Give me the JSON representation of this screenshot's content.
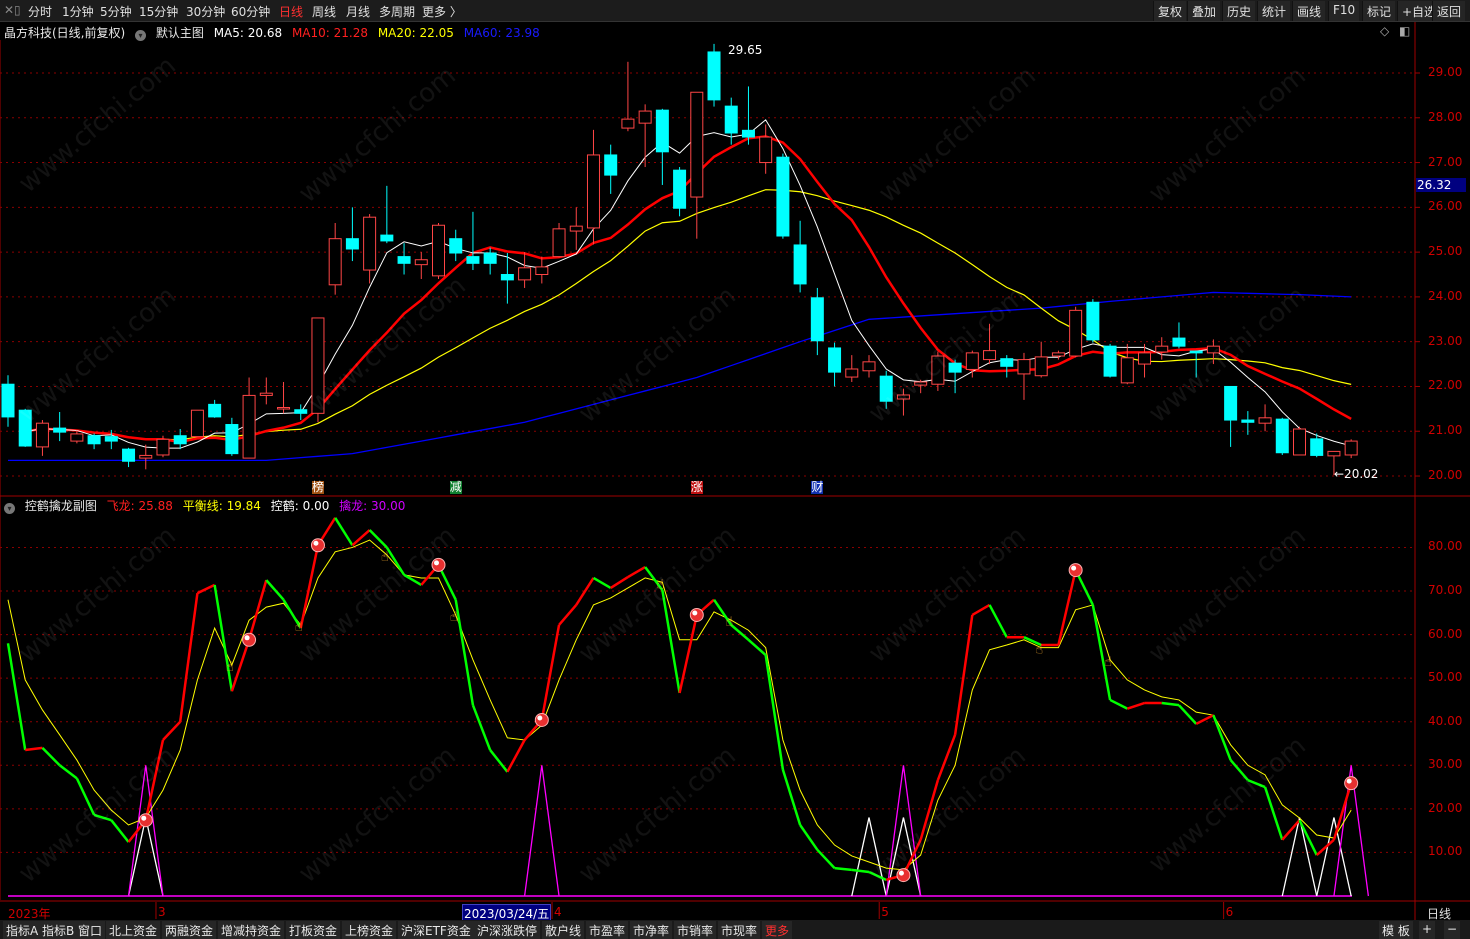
{
  "toolbar": {
    "periods": [
      "分时",
      "1分钟",
      "5分钟",
      "15分钟",
      "30分钟",
      "60分钟",
      "日线",
      "周线",
      "月线",
      "多周期",
      "更多 〉"
    ],
    "active_period": "日线",
    "right_buttons": [
      "复权",
      "叠加",
      "历史",
      "统计",
      "画线",
      "F10",
      "标记",
      "+自选",
      "返回"
    ]
  },
  "main": {
    "stock": "晶方科技(日线,前复权)",
    "template": "默认主图",
    "ma5": "MA5: 20.68",
    "ma10": "MA10: 21.28",
    "ma20": "MA20: 22.05",
    "ma60": "MA60: 23.98",
    "high_label": "29.65",
    "low_label": "←20.02",
    "cursor_price": "26.32",
    "price_ticks": [
      "29.00",
      "28.00",
      "27.00",
      "26.00",
      "25.00",
      "24.00",
      "23.00",
      "22.00",
      "21.00",
      "20.00"
    ],
    "markers": [
      {
        "text": "榜",
        "index": 18,
        "color": "#a05010"
      },
      {
        "text": "减",
        "index": 26,
        "color": "#108030"
      },
      {
        "text": "涨",
        "index": 40,
        "color": "#c01010"
      },
      {
        "text": "财",
        "index": 47,
        "color": "#1030b0"
      }
    ]
  },
  "sub": {
    "title": "控鹤擒龙副图",
    "feilong": "飞龙: 25.88",
    "pingheng": "平衡线: 19.84",
    "konghe": "控鹤: 0.00",
    "qinlong": "擒龙: 30.00",
    "ticks": [
      "80.00",
      "70.00",
      "60.00",
      "50.00",
      "40.00",
      "30.00",
      "20.00",
      "10.00"
    ]
  },
  "xaxis": {
    "year": "2023年",
    "months": [
      {
        "text": "3",
        "index": 9
      },
      {
        "text": "4",
        "index": 32
      },
      {
        "text": "5",
        "index": 51
      },
      {
        "text": "6",
        "index": 71
      }
    ],
    "cursor_date": "2023/03/24/五",
    "period": "日线"
  },
  "bottom": {
    "tabs": [
      "指标A",
      "指标B",
      "窗口",
      "北上资金",
      "两融资金",
      "增减持资金",
      "打板资金",
      "上榜资金",
      "沪深ETF资金",
      "沪深涨跌停",
      "散户线",
      "市盈率",
      "市净率",
      "市销率",
      "市现率",
      "更多"
    ],
    "right": [
      "模 板",
      "+",
      "−"
    ]
  },
  "watermark": "www.cfchi.com",
  "colors": {
    "up": "#ff4646",
    "down": "#00ffff",
    "ma5": "#ffffff",
    "ma10": "#ff0000",
    "ma20": "#ffff00",
    "ma60": "#0000ff",
    "grid": "#8b0000",
    "qinlong": "#ff00ff"
  },
  "chart_data": {
    "type": "candlestick",
    "ohlc": [
      [
        22.05,
        21.32,
        22.25,
        21.1
      ],
      [
        21.47,
        20.67,
        21.5,
        20.65
      ],
      [
        20.65,
        21.18,
        21.25,
        20.45
      ],
      [
        21.07,
        20.98,
        21.43,
        20.78
      ],
      [
        20.78,
        20.94,
        21.02,
        20.73
      ],
      [
        20.9,
        20.72,
        20.95,
        20.6
      ],
      [
        20.88,
        20.78,
        21.03,
        20.6
      ],
      [
        20.6,
        20.33,
        20.63,
        20.2
      ],
      [
        20.4,
        20.46,
        20.7,
        20.15
      ],
      [
        20.47,
        20.82,
        20.9,
        20.42
      ],
      [
        20.9,
        20.72,
        21.05,
        20.6
      ],
      [
        20.88,
        21.47,
        21.47,
        20.88
      ],
      [
        21.6,
        21.32,
        21.7,
        21.3
      ],
      [
        21.15,
        20.5,
        21.3,
        20.45
      ],
      [
        20.4,
        21.8,
        22.2,
        20.4
      ],
      [
        21.8,
        21.85,
        22.2,
        21.6
      ],
      [
        21.5,
        21.53,
        22.1,
        21.4
      ],
      [
        21.48,
        21.4,
        21.6,
        21.25
      ],
      [
        21.4,
        23.53,
        23.53,
        21.2
      ],
      [
        24.27,
        25.3,
        25.65,
        24.05
      ],
      [
        25.3,
        25.07,
        26.0,
        24.8
      ],
      [
        24.6,
        25.78,
        25.85,
        24.3
      ],
      [
        25.38,
        25.25,
        26.48,
        25.2
      ],
      [
        24.9,
        24.75,
        25.2,
        24.5
      ],
      [
        24.72,
        24.83,
        25.0,
        24.4
      ],
      [
        24.47,
        25.6,
        25.65,
        24.4
      ],
      [
        25.3,
        24.98,
        25.5,
        24.8
      ],
      [
        24.9,
        24.75,
        25.9,
        24.6
      ],
      [
        24.98,
        24.75,
        25.1,
        24.5
      ],
      [
        24.5,
        24.38,
        24.98,
        23.85
      ],
      [
        24.38,
        24.65,
        25.0,
        24.2
      ],
      [
        24.5,
        24.67,
        24.9,
        24.3
      ],
      [
        24.9,
        25.52,
        25.65,
        24.88
      ],
      [
        25.47,
        25.58,
        26.0,
        25.05
      ],
      [
        25.54,
        27.17,
        27.73,
        25.17
      ],
      [
        27.17,
        26.72,
        27.4,
        26.3
      ],
      [
        27.77,
        27.97,
        29.25,
        27.7
      ],
      [
        27.88,
        28.15,
        28.3,
        26.9
      ],
      [
        28.17,
        27.24,
        28.2,
        26.5
      ],
      [
        26.83,
        25.98,
        26.9,
        25.8
      ],
      [
        26.23,
        28.57,
        28.57,
        25.3
      ],
      [
        29.47,
        28.4,
        29.65,
        28.25
      ],
      [
        28.26,
        27.66,
        28.45,
        27.4
      ],
      [
        27.72,
        27.57,
        28.7,
        27.4
      ],
      [
        27.0,
        27.57,
        27.85,
        26.75
      ],
      [
        27.12,
        25.36,
        27.2,
        25.3
      ],
      [
        25.16,
        24.29,
        25.7,
        24.1
      ],
      [
        23.98,
        23.02,
        24.2,
        22.7
      ],
      [
        22.86,
        22.32,
        22.98,
        22.0
      ],
      [
        22.21,
        22.39,
        22.7,
        22.1
      ],
      [
        22.35,
        22.55,
        22.7,
        22.2
      ],
      [
        22.23,
        21.67,
        22.35,
        21.5
      ],
      [
        21.72,
        21.81,
        21.95,
        21.35
      ],
      [
        22.03,
        22.1,
        22.15,
        21.85
      ],
      [
        22.05,
        22.68,
        22.78,
        21.9
      ],
      [
        22.52,
        22.32,
        22.6,
        21.85
      ],
      [
        22.38,
        22.75,
        22.8,
        22.2
      ],
      [
        22.6,
        22.8,
        23.4,
        22.5
      ],
      [
        22.62,
        22.45,
        22.7,
        22.2
      ],
      [
        22.28,
        22.6,
        22.75,
        21.7
      ],
      [
        22.24,
        22.66,
        23.0,
        22.2
      ],
      [
        22.68,
        22.75,
        22.8,
        22.6
      ],
      [
        22.68,
        23.7,
        23.78,
        22.65
      ],
      [
        23.88,
        23.04,
        23.95,
        22.98
      ],
      [
        22.9,
        22.23,
        22.95,
        22.2
      ],
      [
        22.08,
        22.64,
        22.95,
        22.05
      ],
      [
        22.5,
        22.75,
        22.95,
        22.2
      ],
      [
        22.77,
        22.9,
        23.1,
        22.6
      ],
      [
        23.08,
        22.9,
        23.43,
        22.85
      ],
      [
        22.79,
        22.75,
        22.8,
        22.2
      ],
      [
        22.75,
        22.9,
        23.05,
        22.5
      ],
      [
        22.0,
        21.25,
        22.0,
        20.65
      ],
      [
        21.25,
        21.2,
        21.45,
        20.92
      ],
      [
        21.18,
        21.3,
        21.6,
        21.0
      ],
      [
        21.27,
        20.52,
        21.3,
        20.47
      ],
      [
        20.47,
        21.05,
        21.1,
        20.47
      ],
      [
        20.83,
        20.46,
        20.95,
        20.42
      ],
      [
        20.45,
        20.55,
        20.55,
        20.02
      ],
      [
        20.47,
        20.78,
        20.82,
        20.4
      ]
    ],
    "ma60_keypoints": [
      [
        0,
        20.35
      ],
      [
        15,
        20.35
      ],
      [
        20,
        20.5
      ],
      [
        30,
        21.2
      ],
      [
        40,
        22.2
      ],
      [
        46,
        23.0
      ],
      [
        50,
        23.5
      ],
      [
        60,
        23.75
      ],
      [
        64,
        23.9
      ],
      [
        70,
        24.1
      ],
      [
        75,
        24.05
      ],
      [
        78,
        24.0
      ]
    ],
    "price_range": [
      19.5,
      29.9
    ],
    "feilong": [
      58,
      33.5,
      34,
      30,
      27,
      18.6,
      17.4,
      12.4,
      17.4,
      35.8,
      40,
      69.5,
      71.4,
      47,
      58.8,
      72.5,
      68,
      61.5,
      80.5,
      86.8,
      80.5,
      84,
      80,
      73.7,
      71.4,
      76,
      68,
      43.8,
      33.5,
      28.5,
      35.8,
      40.4,
      62.2,
      66.8,
      73,
      70.7,
      73.2,
      75.5,
      70.2,
      46.6,
      64.5,
      68,
      62.2,
      58.8,
      55.3,
      29,
      16.3,
      10.6,
      6.4,
      6,
      5.5,
      3.7,
      4.8,
      12.9,
      26.6,
      37,
      64.5,
      66.8,
      59.4,
      59.4,
      57.6,
      57.6,
      74.8,
      66.8,
      45,
      43,
      44.3,
      44.3,
      43.8,
      39.5,
      41.5,
      31.2,
      26.6,
      25,
      12.9,
      17.4,
      9.4,
      12.9,
      25.9
    ],
    "pingheng": [
      68,
      49.6,
      42.7,
      37,
      31.2,
      24.3,
      19.7,
      16.3,
      17.9,
      24.3,
      33.5,
      49.6,
      61.5,
      53,
      63.3,
      66.3,
      67.2,
      62.2,
      73,
      79,
      80,
      81.7,
      78.3,
      73.7,
      73,
      73,
      64.5,
      54.2,
      45,
      36.3,
      35.8,
      39.2,
      49.6,
      58.8,
      66.8,
      68.4,
      70.7,
      73,
      72,
      58.8,
      58.8,
      65.2,
      63.3,
      61,
      57,
      35.8,
      24.3,
      16.3,
      11.7,
      9.2,
      7.8,
      6.4,
      6,
      9.4,
      22,
      30,
      47.3,
      56.5,
      57.6,
      58.8,
      57,
      57,
      65.7,
      66.8,
      54.2,
      49.6,
      47.3,
      45.7,
      45,
      42.2,
      41.5,
      34.7,
      30,
      27.8,
      20.9,
      17.9,
      14,
      13.3,
      19.7
    ],
    "konghe_spikes": [
      [
        8,
        18
      ],
      [
        50,
        18
      ],
      [
        52,
        18
      ],
      [
        75,
        18
      ],
      [
        77,
        18
      ]
    ],
    "qinlong_spikes": [
      [
        8,
        30
      ],
      [
        31,
        30
      ],
      [
        52,
        30
      ],
      [
        78,
        30
      ]
    ],
    "buy_signal_indices": [
      8,
      14,
      18,
      25,
      31,
      40,
      52,
      62,
      78
    ],
    "hand_signal_indices": [
      13,
      17,
      22,
      26,
      38,
      42,
      60,
      64
    ],
    "sub_range": [
      0,
      90
    ]
  }
}
